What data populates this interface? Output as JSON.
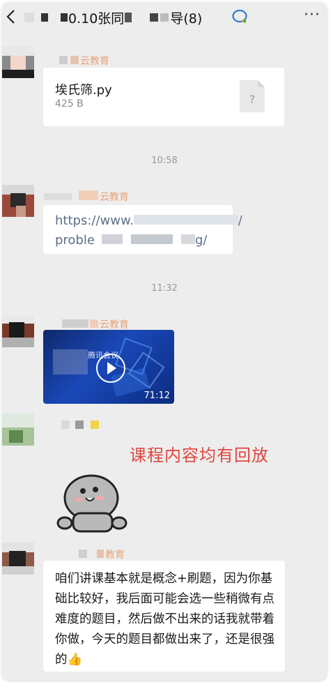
{
  "header": {
    "title": "0.10张同",
    "title_suffix": "导(8)",
    "back_icon": "chevron-left-icon",
    "wework_icon": "wework-icon",
    "more_label": "···"
  },
  "messages": [
    {
      "sender": "云教育",
      "type": "file",
      "file_name": "埃氏筛.py",
      "file_size": "425 B",
      "file_icon_glyph": "?"
    },
    {
      "time": "10:58"
    },
    {
      "sender": "云教育",
      "type": "link",
      "line1": "https://www.",
      "line1_end": "/",
      "line2": "proble",
      "line2_end": "g/"
    },
    {
      "time": "11:32"
    },
    {
      "sender": "云教育",
      "type": "video",
      "title": "腾讯会议",
      "duration": "71:12"
    },
    {
      "type": "sticker"
    },
    {
      "sender": "教育",
      "type": "text",
      "text": "咱们讲课基本就是概念+刷题，因为你基础比较好，我后面可能会选一些稍微有点难度的题目，然后做不出来的话我就带着你做，今天的题目都做出来了，还是很强的👍"
    }
  ],
  "overlay": {
    "text": "课程内容均有回放",
    "color": "#e0463d"
  },
  "colors": {
    "background": "#ededed",
    "bubble": "#ffffff",
    "sender": "#e8a27a"
  }
}
